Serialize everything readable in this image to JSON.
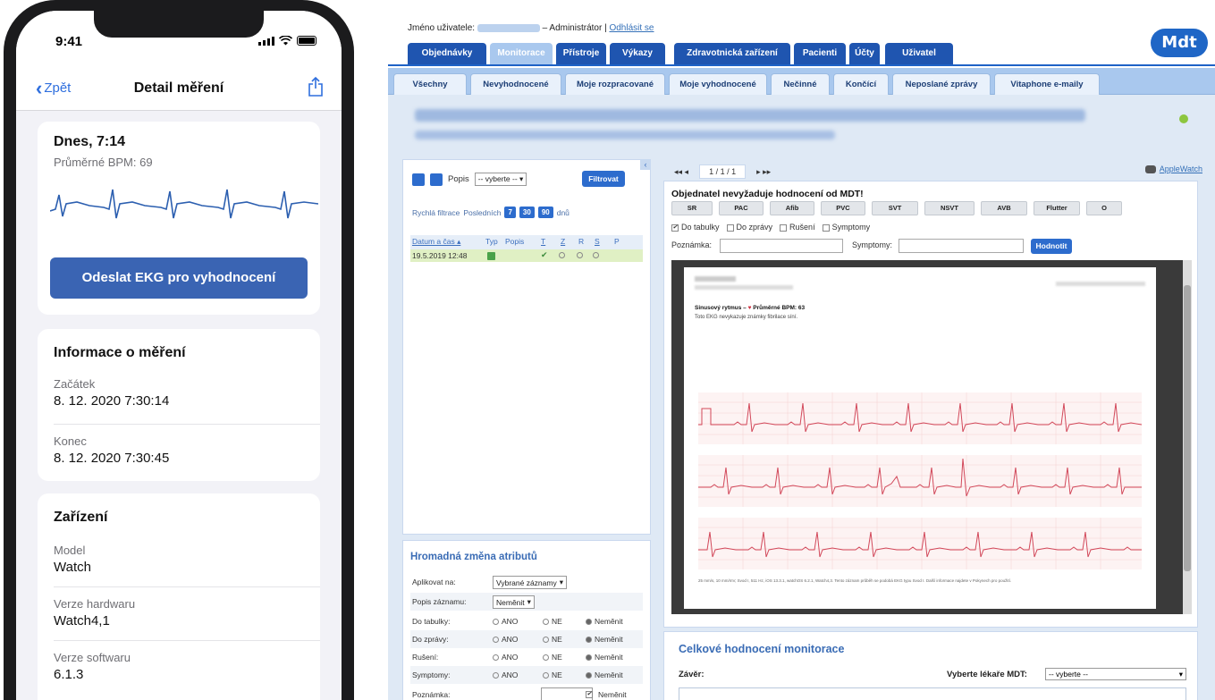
{
  "phone": {
    "status_time": "9:41",
    "back_label": "Zpět",
    "title": "Detail měření",
    "measure_card": {
      "heading": "Dnes, 7:14",
      "avg_bpm": "Průměrné BPM: 69",
      "send_button": "Odeslat EKG pro vyhodnocení"
    },
    "info_card": {
      "title": "Informace o měření",
      "start_label": "Začátek",
      "start_value": "8. 12. 2020 7:30:14",
      "end_label": "Konec",
      "end_value": "8. 12. 2020 7:30:45"
    },
    "device_card": {
      "title": "Zařízení",
      "model_label": "Model",
      "model_value": "Watch",
      "hw_label": "Verze hardwaru",
      "hw_value": "Watch4,1",
      "sw_label": "Verze softwaru",
      "sw_value": "6.1.3"
    }
  },
  "web": {
    "user_prefix": "Jméno uživatele:",
    "user_role": "– Administrátor",
    "logout": "Odhlásit se",
    "logo": "Mdt",
    "main_tabs": [
      "Objednávky",
      "Monitorace",
      "Přístroje",
      "Výkazy",
      "Zdravotnická zařízení",
      "Pacienti",
      "Účty",
      "Uživatel"
    ],
    "sub_tabs": [
      "Všechny",
      "Nevyhodnocené",
      "Moje rozpracované",
      "Moje vyhodnocené",
      "Nečinné",
      "Končící",
      "Neposlané zprávy",
      "Vitaphone e-maily"
    ],
    "filter": {
      "popis_label": "Popis",
      "popis_select": "-- vyberte --",
      "filter_button": "Filtrovat",
      "quick_label": "Rychlá filtrace",
      "quick_last": "Posledních",
      "quick_days": [
        "7",
        "30",
        "90"
      ],
      "quick_unit": "dnů"
    },
    "table": {
      "headers": [
        "Datum a čas ▴",
        "Typ",
        "Popis",
        "T",
        "Z",
        "R",
        "S",
        "P"
      ],
      "row_date": "19.5.2019 12:48"
    },
    "mass_change": {
      "title": "Hromadná změna atributů",
      "apply_label": "Aplikovat na:",
      "apply_value": "Vybrané záznamy",
      "desc_label": "Popis záznamu:",
      "desc_value": "Neměnit",
      "rows": [
        "Do tabulky:",
        "Do zprávy:",
        "Rušení:",
        "Symptomy:"
      ],
      "opt_yes": "ANO",
      "opt_no": "NE",
      "opt_keep": "Neměnit",
      "note_label": "Poznámka:",
      "note_keep": "Neměnit"
    },
    "pager": {
      "page": "1 / 1 / 1",
      "applewatch": "AppleWatch"
    },
    "evaluation": {
      "title": "Objednatel nevyžaduje hodnocení od MDT!",
      "rhythms": [
        "SR",
        "PAC",
        "Afib",
        "PVC",
        "SVT",
        "NSVT",
        "AVB",
        "Flutter",
        "O"
      ],
      "checks": [
        "Do tabulky",
        "Do zprávy",
        "Rušení",
        "Symptomy"
      ],
      "note_label": "Poznámka:",
      "symptoms_label": "Symptomy:",
      "rate_button": "Hodnotit"
    },
    "ecg_page": {
      "rhythm": "Sinusový rytmus –",
      "heart": "♥",
      "bpm": "Průměrné BPM: 63",
      "desc": "Toto EKG nevykazuje známky fibrilace síní.",
      "footer": "25 mm/s, 10 mm/mV, Svod I, 511 Hz, iOS 13.3.1, watchOS 6.2.1, Watch4,3. Tento záznam průběh se podobá EKG typu Svod I. Další informace najdete v Pokynech pro použití."
    },
    "overall": {
      "title": "Celkové hodnocení monitorace",
      "conclusion_label": "Závěr:",
      "doctor_label": "Vyberte lékaře MDT:",
      "doctor_select": "-- vyberte --"
    }
  }
}
